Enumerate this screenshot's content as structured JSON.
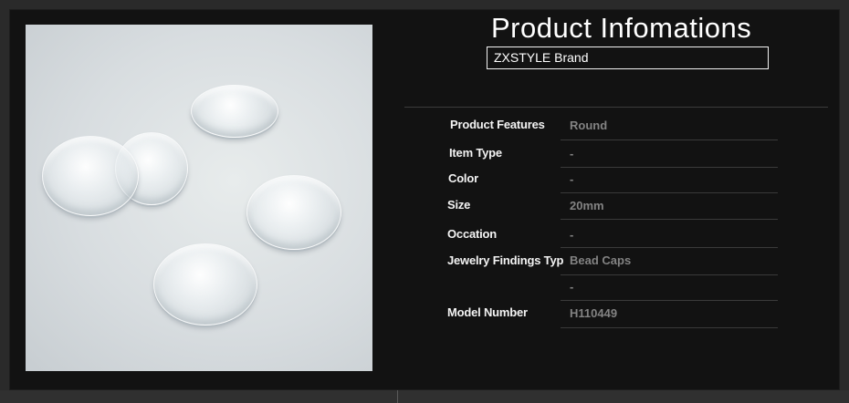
{
  "header": {
    "title": "Product Infomations",
    "brand": "ZXSTYLE Brand"
  },
  "product_image": {
    "icon": "clear-glass-cabochon-image",
    "alt_colors": [
      "#d8dde0",
      "#ffffff"
    ]
  },
  "specs": [
    {
      "label": "Product Features",
      "value": "Round"
    },
    {
      "label": "Item Type",
      "value": "-"
    },
    {
      "label": "Color",
      "value": "-"
    },
    {
      "label": "Size",
      "value": "20mm"
    },
    {
      "label": "Occation",
      "value": "-"
    },
    {
      "label": "Jewelry Findings Typ",
      "value": "Bead Caps"
    },
    {
      "label": "",
      "value": "-"
    },
    {
      "label": "Model Number",
      "value": "H110449"
    }
  ],
  "colors": {
    "background": "#2a2a2a",
    "panel": "#121212",
    "label": "#f3f3f3",
    "value": "#838383"
  }
}
